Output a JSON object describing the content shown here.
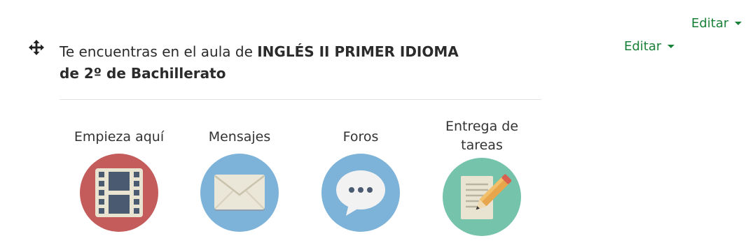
{
  "header": {
    "edit_menu_top": "Editar",
    "edit_menu_section": "Editar"
  },
  "section": {
    "intro_plain": "Te encuentras en el aula de ",
    "intro_bold_1": "INGLÉS II PRIMER IDIOMA",
    "intro_bold_2": "de 2º de Bachillerato"
  },
  "tiles": [
    {
      "label": "Empieza aquí",
      "icon": "film-icon",
      "color": "#c45c5c"
    },
    {
      "label": "Mensajes",
      "icon": "envelope-icon",
      "color": "#7eb3d9"
    },
    {
      "label": "Foros",
      "icon": "chat-bubble-icon",
      "color": "#7eb3d9"
    },
    {
      "label_line1": "Entrega de",
      "label_line2": "tareas",
      "icon": "document-pencil-icon",
      "color": "#76c3ac"
    }
  ],
  "colors": {
    "accent": "#188038",
    "text": "#2b2b2b"
  }
}
